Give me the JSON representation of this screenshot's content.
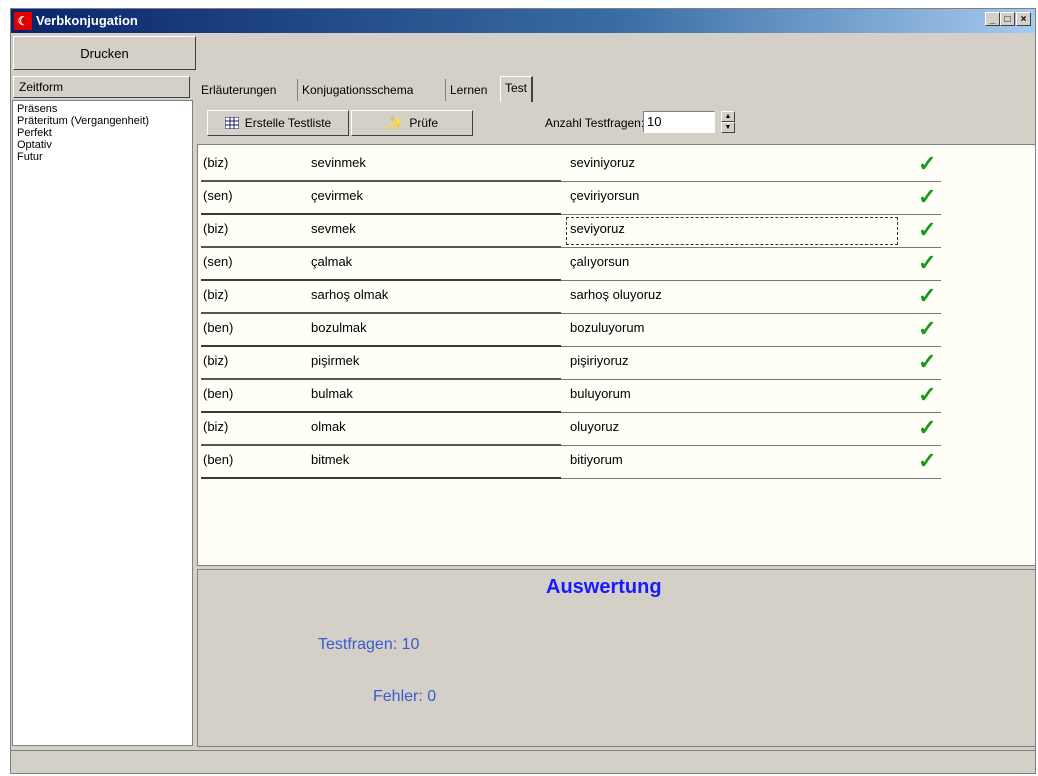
{
  "window": {
    "title": "Verbkonjugation",
    "controls": {
      "minimize": "_",
      "maximize": "□",
      "close": "×"
    }
  },
  "toolbar_top": {
    "print_label": "Drucken"
  },
  "sidebar": {
    "header": "Zeitform",
    "items": [
      {
        "label": "Präsens"
      },
      {
        "label": "Präteritum (Vergangenheit)"
      },
      {
        "label": "Perfekt"
      },
      {
        "label": "Optativ"
      },
      {
        "label": "Futur"
      }
    ]
  },
  "tabs": [
    {
      "label": "Erläuterungen"
    },
    {
      "label": "Konjugationsschema"
    },
    {
      "label": "Lernen"
    },
    {
      "label": "Test",
      "active": true
    }
  ],
  "test_toolbar": {
    "create_label": "Erstelle Testliste",
    "check_label": "Prüfe",
    "count_label": "Anzahl Testfragen:",
    "count_value": "10"
  },
  "rows": [
    {
      "pronoun": "(biz)",
      "infinitive": "sevinmek",
      "answer": "seviniyoruz"
    },
    {
      "pronoun": "(sen)",
      "infinitive": "çevirmek",
      "answer": "çeviriyorsun"
    },
    {
      "pronoun": "(biz)",
      "infinitive": "sevmek",
      "answer": "seviyoruz"
    },
    {
      "pronoun": "(sen)",
      "infinitive": "çalmak",
      "answer": "çalıyorsun"
    },
    {
      "pronoun": "(biz)",
      "infinitive": "sarhoş olmak",
      "answer": "sarhoş oluyoruz"
    },
    {
      "pronoun": "(ben)",
      "infinitive": "bozulmak",
      "answer": "bozuluyorum"
    },
    {
      "pronoun": "(biz)",
      "infinitive": "pişirmek",
      "answer": "pişiriyoruz"
    },
    {
      "pronoun": "(ben)",
      "infinitive": "bulmak",
      "answer": "buluyorum"
    },
    {
      "pronoun": "(biz)",
      "infinitive": "olmak",
      "answer": "oluyoruz"
    },
    {
      "pronoun": "(ben)",
      "infinitive": "bitmek",
      "answer": "bitiyorum"
    }
  ],
  "row_check_icon": "checkmark-icon",
  "evaluation": {
    "title": "Auswertung",
    "questions": "Testfragen: 10",
    "errors": "Fehler: 0"
  },
  "colors": {
    "check": "#1a9a1a",
    "eval_title": "#1a1aff",
    "eval_text": "#3a5bd0"
  }
}
